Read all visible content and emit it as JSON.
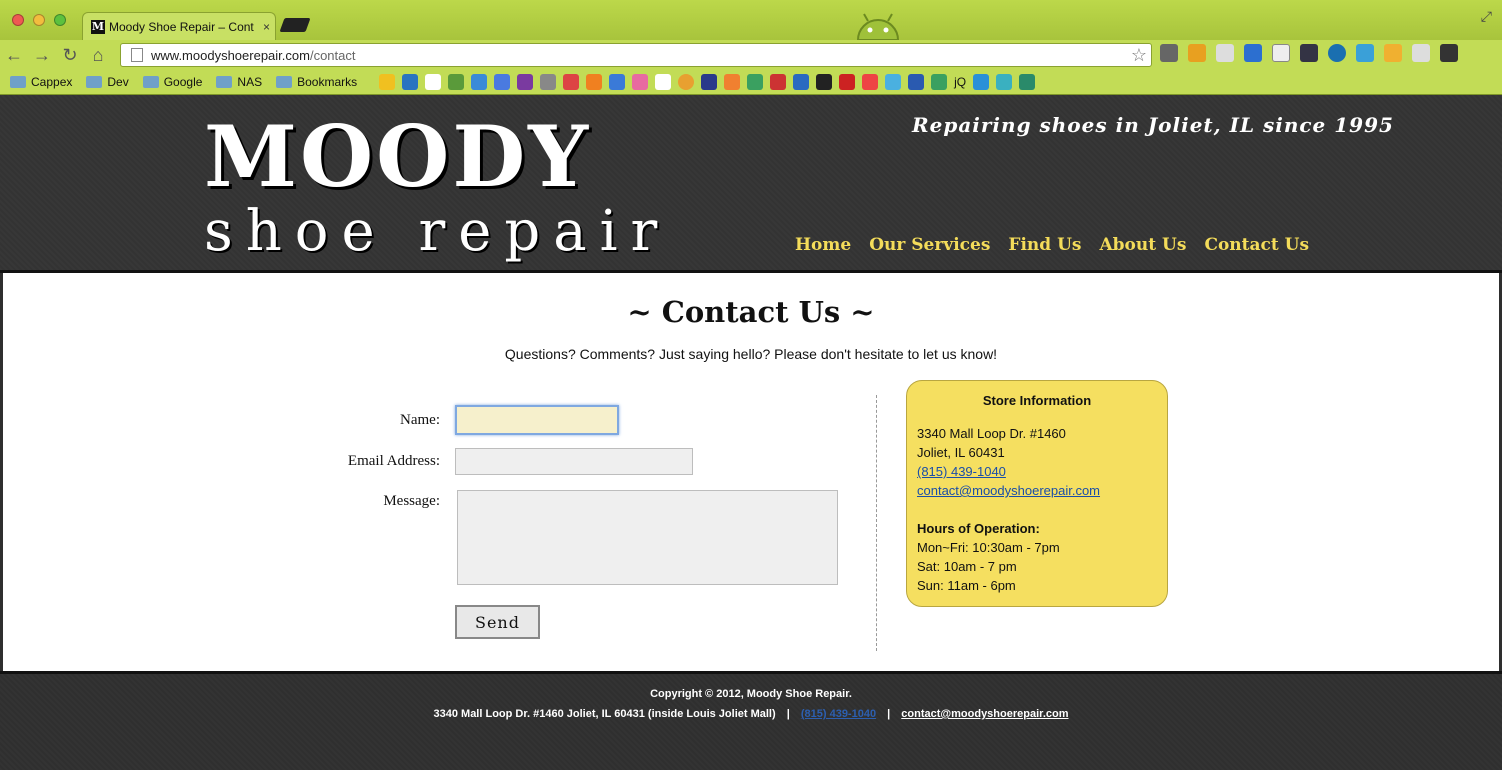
{
  "browser": {
    "tab_title": "Moody Shoe Repair – Cont",
    "tab_favicon": "M",
    "tab_close": "×",
    "url_host": "www.moodyshoerepair.com",
    "url_path": "/contact",
    "bookmarks": [
      "Cappex",
      "Dev",
      "Google",
      "NAS",
      "Bookmarks"
    ],
    "bookmark_jq": "jQ"
  },
  "header": {
    "logo_line1": "MOODY",
    "logo_line2": "shoe repair",
    "tagline": "Repairing shoes in Joliet, IL since 1995",
    "nav": [
      "Home",
      "Our Services",
      "Find Us",
      "About Us",
      "Contact Us"
    ]
  },
  "main": {
    "title": "~ Contact Us ~",
    "intro": "Questions? Comments? Just saying hello? Please don't hesitate to let us know!",
    "form": {
      "name_label": "Name:",
      "email_label": "Email Address:",
      "message_label": "Message:",
      "name_value": "",
      "email_value": "",
      "message_value": "",
      "send_label": "Send"
    },
    "store": {
      "title": "Store Information",
      "address1": "3340 Mall Loop Dr. #1460",
      "address2": "Joliet, IL 60431",
      "phone": "(815) 439-1040",
      "email": "contact@moodyshoerepair.com",
      "hours_title": "Hours of Operation:",
      "hours": [
        "Mon~Fri: 10:30am - 7pm",
        "Sat: 10am - 7 pm",
        "Sun: 11am - 6pm"
      ]
    }
  },
  "footer": {
    "copyright": "Copyright © 2012, Moody Shoe Repair.",
    "address": "3340 Mall Loop Dr. #1460 Joliet, IL 60431 (inside Louis Joliet Mall)",
    "separator": "|",
    "phone": "(815) 439-1040",
    "email": "contact@moodyshoerepair.com"
  },
  "colors": {
    "chrome": "#c2dc56",
    "header_bg": "#333333",
    "nav_link": "#f4dc5a",
    "store_box": "#f5df60"
  }
}
